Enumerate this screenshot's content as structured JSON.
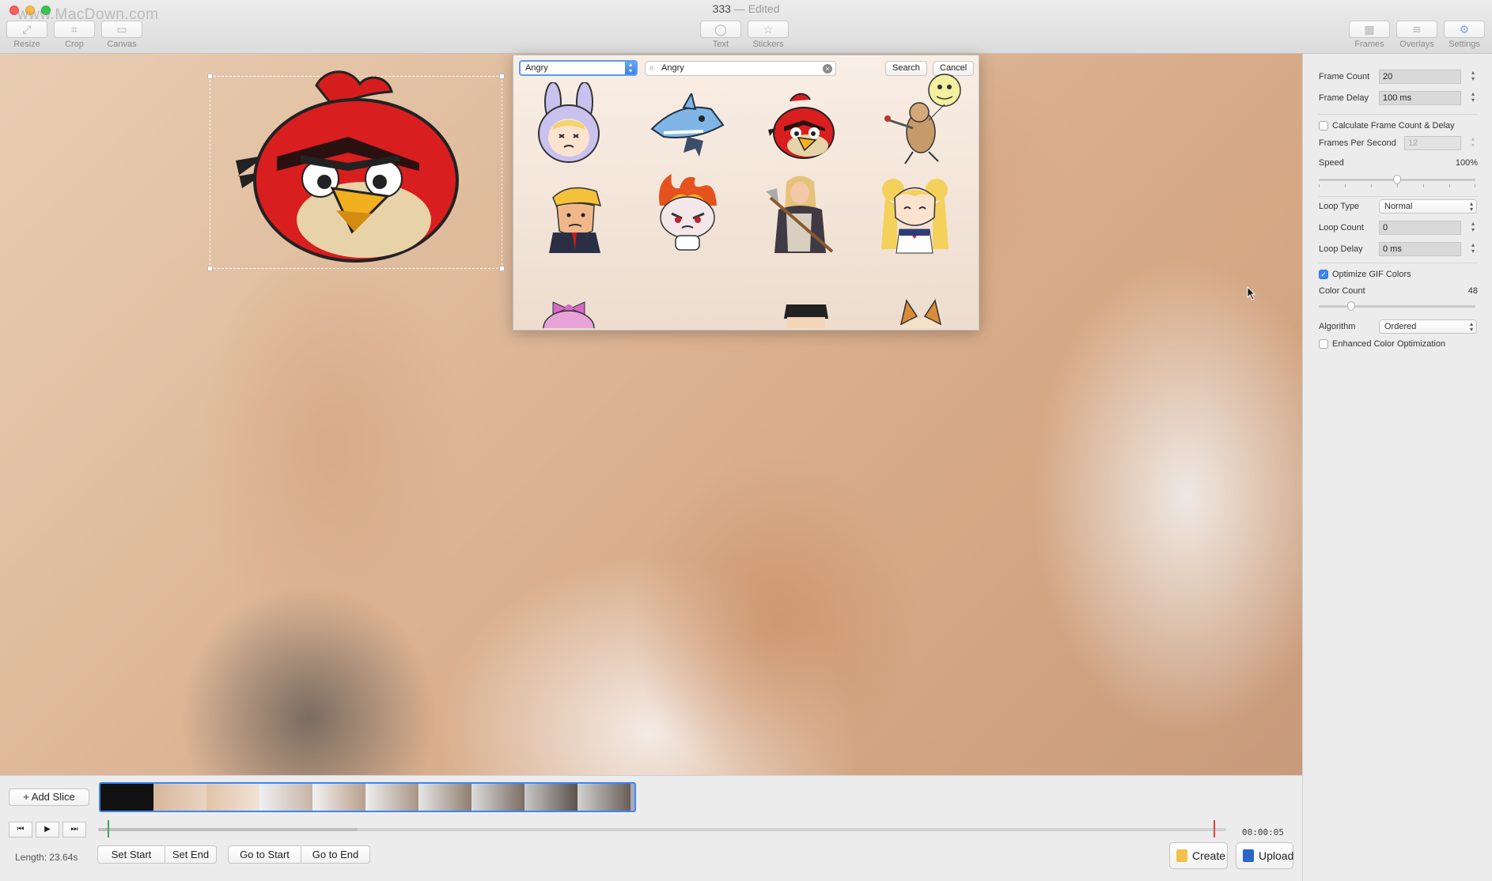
{
  "window": {
    "watermark": "www.MacDown.com",
    "title": "333",
    "title_suffix": "— Edited"
  },
  "toolbar": {
    "left": [
      {
        "label": "Resize",
        "icon": "resize-icon"
      },
      {
        "label": "Crop",
        "icon": "crop-icon"
      },
      {
        "label": "Canvas",
        "icon": "canvas-icon"
      }
    ],
    "center": [
      {
        "label": "Text",
        "icon": "speech-bubble-icon"
      },
      {
        "label": "Stickers",
        "icon": "star-icon"
      }
    ],
    "right": [
      {
        "label": "Frames",
        "icon": "frames-icon"
      },
      {
        "label": "Overlays",
        "icon": "layers-icon"
      },
      {
        "label": "Settings",
        "icon": "gear-icon"
      }
    ]
  },
  "sticker_picker": {
    "category": "Angry",
    "search_value": "Angry",
    "search_button": "Search",
    "cancel_button": "Cancel",
    "stickers": [
      "bunny-hood-girl",
      "angry-shark",
      "angry-bird",
      "dancing-mouse",
      "trump-caricature",
      "flaming-devil",
      "girl-with-axe",
      "sailor-moon",
      "pink-bow-character",
      "black-hair-character",
      "corgi-ears"
    ]
  },
  "settings": {
    "frame_count_label": "Frame Count",
    "frame_count": "20",
    "frame_delay_label": "Frame Delay",
    "frame_delay": "100 ms",
    "calc_label": "Calculate Frame Count & Delay",
    "calc_checked": false,
    "fps_label": "Frames Per Second",
    "fps": "12",
    "speed_label": "Speed",
    "speed_value": "100%",
    "speed_level": 0.5,
    "loop_type_label": "Loop Type",
    "loop_type": "Normal",
    "loop_count_label": "Loop Count",
    "loop_count": "0",
    "loop_delay_label": "Loop Delay",
    "loop_delay": "0 ms",
    "optimize_label": "Optimize GIF Colors",
    "optimize_checked": true,
    "color_count_label": "Color Count",
    "color_count": "48",
    "color_count_level": 0.19,
    "algorithm_label": "Algorithm",
    "algorithm": "Ordered",
    "enhanced_label": "Enhanced Color Optimization",
    "enhanced_checked": false
  },
  "bottom": {
    "add_slice": "+ Add Slice",
    "time": "00:00:05",
    "played_fraction": 0.23,
    "length": "Length: 23.64s",
    "slice_buttons": [
      "Set Start",
      "Set End",
      "Go to Start",
      "Go to End"
    ],
    "create": "Create",
    "upload": "Upload",
    "colors": {
      "start_marker": "#3aa85a",
      "end_marker": "#e0443a",
      "accent": "#3d86f0"
    }
  }
}
